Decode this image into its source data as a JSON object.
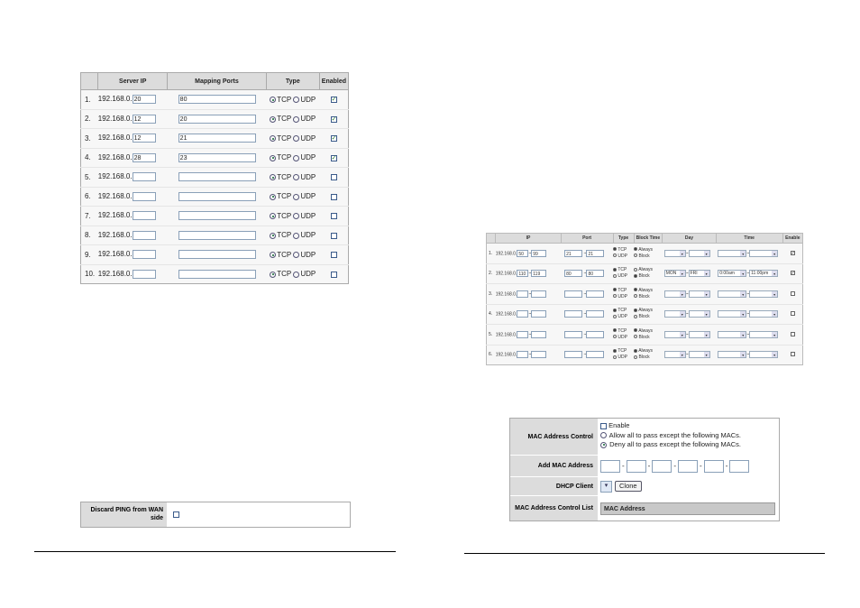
{
  "port_table": {
    "headers": [
      "Server IP",
      "Mapping Ports",
      "Type",
      "Enabled"
    ],
    "ip_prefix": "192.168.0.",
    "tcp_label": "TCP",
    "udp_label": "UDP",
    "rows": [
      {
        "num": "1.",
        "ip": "20",
        "ports": "80",
        "enabled": true
      },
      {
        "num": "2.",
        "ip": "12",
        "ports": "20",
        "enabled": true
      },
      {
        "num": "3.",
        "ip": "12",
        "ports": "21",
        "enabled": true
      },
      {
        "num": "4.",
        "ip": "28",
        "ports": "23",
        "enabled": true
      },
      {
        "num": "5.",
        "ip": "",
        "ports": "",
        "enabled": false
      },
      {
        "num": "6.",
        "ip": "",
        "ports": "",
        "enabled": false
      },
      {
        "num": "7.",
        "ip": "",
        "ports": "",
        "enabled": false
      },
      {
        "num": "8.",
        "ip": "",
        "ports": "",
        "enabled": false
      },
      {
        "num": "9.",
        "ip": "",
        "ports": "",
        "enabled": false
      },
      {
        "num": "10.",
        "ip": "",
        "ports": "",
        "enabled": false
      }
    ]
  },
  "filter_table": {
    "headers": [
      "IP",
      "Port",
      "Type",
      "Block Time",
      "Day",
      "Time",
      "Enable"
    ],
    "ip_prefix": "192.168.0.",
    "tcp_label": "TCP",
    "udp_label": "UDP",
    "always_label": "Always",
    "block_label": "Block",
    "rows": [
      {
        "num": "1.",
        "ip_from": "50",
        "ip_to": "99",
        "port_from": "21",
        "port_to": "21",
        "tcp": true,
        "always": true,
        "day_from": "",
        "day_to": "",
        "time_from": "",
        "time_to": "",
        "enabled": true
      },
      {
        "num": "2.",
        "ip_from": "110",
        "ip_to": "119",
        "port_from": "80",
        "port_to": "80",
        "tcp": true,
        "always": false,
        "day_from": "MON",
        "day_to": "FRI",
        "time_from": "0:00am",
        "time_to": "11:00pm",
        "enabled": true
      },
      {
        "num": "3.",
        "ip_from": "",
        "ip_to": "",
        "port_from": "",
        "port_to": "",
        "tcp": true,
        "always": true,
        "day_from": "",
        "day_to": "",
        "time_from": "",
        "time_to": "",
        "enabled": false
      },
      {
        "num": "4.",
        "ip_from": "",
        "ip_to": "",
        "port_from": "",
        "port_to": "",
        "tcp": true,
        "always": true,
        "day_from": "",
        "day_to": "",
        "time_from": "",
        "time_to": "",
        "enabled": false
      },
      {
        "num": "5.",
        "ip_from": "",
        "ip_to": "",
        "port_from": "",
        "port_to": "",
        "tcp": true,
        "always": true,
        "day_from": "",
        "day_to": "",
        "time_from": "",
        "time_to": "",
        "enabled": false
      },
      {
        "num": "6.",
        "ip_from": "",
        "ip_to": "",
        "port_from": "",
        "port_to": "",
        "tcp": true,
        "always": true,
        "day_from": "",
        "day_to": "",
        "time_from": "",
        "time_to": "",
        "enabled": false
      }
    ]
  },
  "ping": {
    "label": "Discard PING from WAN side"
  },
  "mac": {
    "control_label": "MAC Address Control",
    "enable_label": "Enable",
    "allow_label": "Allow all to pass except the following MACs.",
    "deny_label": "Deny all to pass except the following MACs.",
    "add_label": "Add MAC Address",
    "dhcp_label": "DHCP Client",
    "clone_label": "Clone",
    "list_label": "MAC Address Control List",
    "list_header": "MAC Address",
    "separator": "-"
  }
}
